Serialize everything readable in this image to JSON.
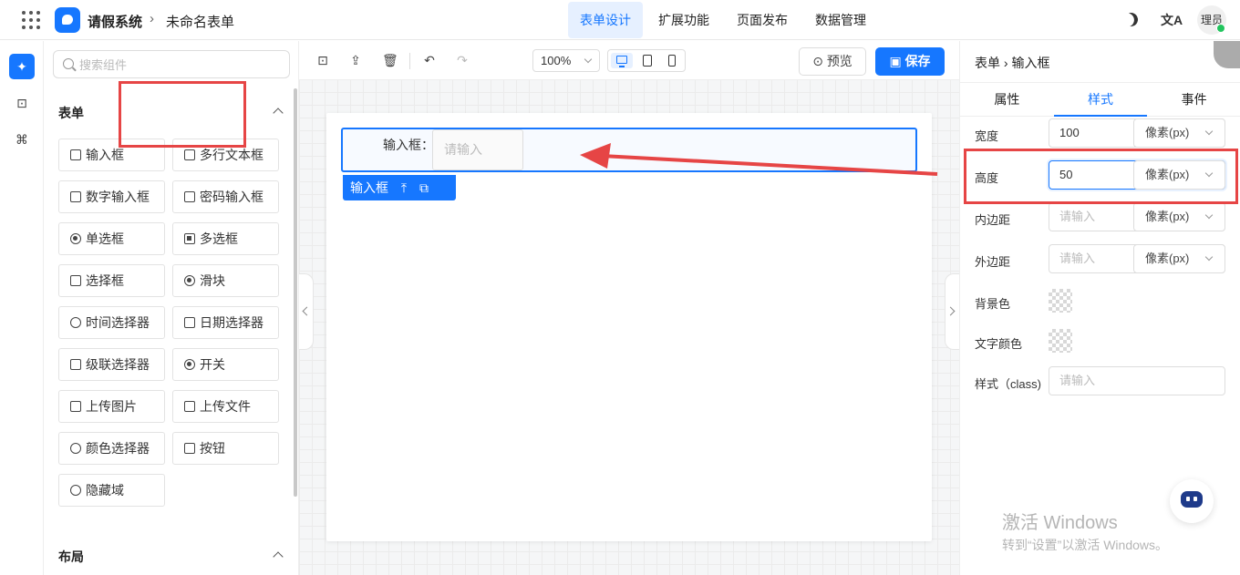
{
  "header": {
    "app_name": "请假系统",
    "crumb_sep": "›",
    "form_name": "未命名表单",
    "tabs": [
      {
        "label": "表单设计",
        "active": true
      },
      {
        "label": "扩展功能",
        "active": false
      },
      {
        "label": "页面发布",
        "active": false
      },
      {
        "label": "数据管理",
        "active": false
      }
    ],
    "lang_glyph": "文A",
    "avatar_text": "理员"
  },
  "component_panel": {
    "search_placeholder": "搜索组件",
    "section_form": "表单",
    "section_layout": "布局",
    "components": [
      "输入框",
      "多行文本框",
      "数字输入框",
      "密码输入框",
      "单选框",
      "多选框",
      "选择框",
      "滑块",
      "时间选择器",
      "日期选择器",
      "级联选择器",
      "开关",
      "上传图片",
      "上传文件",
      "颜色选择器",
      "按钮",
      "隐藏域"
    ]
  },
  "toolbar": {
    "zoom": "100%",
    "preview_label": "预览",
    "save_label": "保存"
  },
  "canvas": {
    "field_label": "输入框：",
    "field_placeholder": "请输入",
    "selected_tag": "输入框"
  },
  "properties": {
    "crumb": "表单 › 输入框",
    "tabs": [
      {
        "label": "属性",
        "active": false
      },
      {
        "label": "样式",
        "active": true
      },
      {
        "label": "事件",
        "active": false
      }
    ],
    "width_label": "宽度",
    "width_value": "100",
    "height_label": "高度",
    "height_value": "50",
    "padding_label": "内边距",
    "margin_label": "外边距",
    "bg_label": "背景色",
    "text_color_label": "文字颜色",
    "class_label": "样式（class)",
    "unit": "像素(px)",
    "input_placeholder": "请输入"
  },
  "watermark": {
    "line1": "激活 Windows",
    "line2": "转到“设置”以激活 Windows。"
  },
  "colors": {
    "accent": "#1677ff",
    "highlight": "#e64545"
  }
}
